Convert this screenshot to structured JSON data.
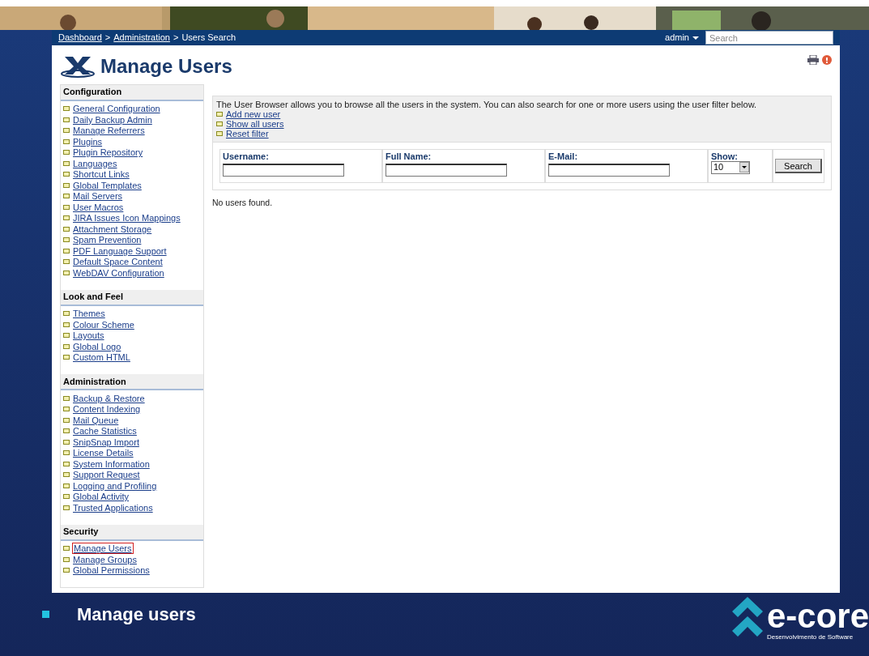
{
  "breadcrumb": {
    "separator": ">",
    "items": [
      {
        "label": "Dashboard",
        "link": true
      },
      {
        "label": "Administration",
        "link": true
      },
      {
        "label": "Users Search",
        "link": false
      }
    ]
  },
  "user_menu": "admin",
  "search": {
    "placeholder": "Search"
  },
  "page_title": "Manage Users",
  "sidebar": [
    {
      "title": "Configuration",
      "items": [
        {
          "label": "General Configuration",
          "selected": false
        },
        {
          "label": "Daily Backup Admin",
          "selected": false
        },
        {
          "label": "Manage Referrers",
          "selected": false
        },
        {
          "label": "Plugins",
          "selected": false
        },
        {
          "label": "Plugin Repository",
          "selected": false
        },
        {
          "label": "Languages",
          "selected": false
        },
        {
          "label": "Shortcut Links",
          "selected": false
        },
        {
          "label": "Global Templates",
          "selected": false
        },
        {
          "label": "Mail Servers",
          "selected": false
        },
        {
          "label": "User Macros",
          "selected": false
        },
        {
          "label": "JIRA Issues Icon Mappings",
          "selected": false
        },
        {
          "label": "Attachment Storage",
          "selected": false
        },
        {
          "label": "Spam Prevention",
          "selected": false
        },
        {
          "label": "PDF Language Support",
          "selected": false
        },
        {
          "label": "Default Space Content",
          "selected": false
        },
        {
          "label": "WebDAV Configuration",
          "selected": false
        }
      ]
    },
    {
      "title": "Look and Feel",
      "items": [
        {
          "label": "Themes",
          "selected": false
        },
        {
          "label": "Colour Scheme",
          "selected": false
        },
        {
          "label": "Layouts",
          "selected": false
        },
        {
          "label": "Global Logo",
          "selected": false
        },
        {
          "label": "Custom HTML",
          "selected": false
        }
      ]
    },
    {
      "title": "Administration",
      "items": [
        {
          "label": "Backup & Restore",
          "selected": false
        },
        {
          "label": "Content Indexing",
          "selected": false
        },
        {
          "label": "Mail Queue",
          "selected": false
        },
        {
          "label": "Cache Statistics",
          "selected": false
        },
        {
          "label": "SnipSnap Import",
          "selected": false
        },
        {
          "label": "License Details",
          "selected": false
        },
        {
          "label": "System Information",
          "selected": false
        },
        {
          "label": "Support Request",
          "selected": false
        },
        {
          "label": "Logging and Profiling",
          "selected": false
        },
        {
          "label": "Global Activity",
          "selected": false
        },
        {
          "label": "Trusted Applications",
          "selected": false
        }
      ]
    },
    {
      "title": "Security",
      "items": [
        {
          "label": "Manage Users",
          "selected": true
        },
        {
          "label": "Manage Groups",
          "selected": false
        },
        {
          "label": "Global Permissions",
          "selected": false
        }
      ]
    }
  ],
  "intro": {
    "text": "The User Browser allows you to browse all the users in the system. You can also search for one or more users using the user filter below.",
    "links": [
      "Add new user",
      "Show all users",
      "Reset filter"
    ]
  },
  "filters": [
    {
      "label": "Username:",
      "kind": "text"
    },
    {
      "label": "Full Name:",
      "kind": "text"
    },
    {
      "label": "E-Mail:",
      "kind": "text"
    },
    {
      "label": "Show:",
      "kind": "select",
      "value": "10"
    }
  ],
  "search_button": "Search",
  "result": "No users found.",
  "slide": {
    "bullet": "Manage users",
    "logo_name": "e-core",
    "logo_tagline": "Desenvolvimento de Software"
  }
}
